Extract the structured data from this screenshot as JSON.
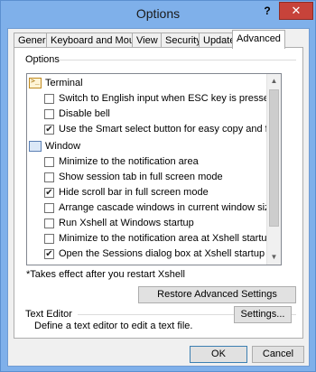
{
  "window": {
    "title": "Options",
    "help_glyph": "?",
    "close_glyph": "✕"
  },
  "tabs": [
    {
      "label": "General"
    },
    {
      "label": "Keyboard and Mouse"
    },
    {
      "label": "View"
    },
    {
      "label": "Security"
    },
    {
      "label": "Update"
    },
    {
      "label": "Advanced"
    }
  ],
  "options": {
    "group_label": "Options",
    "terminal": {
      "category": "Terminal",
      "items": [
        {
          "label": "Switch to English input when ESC key is pressed",
          "checked": false
        },
        {
          "label": "Disable bell",
          "checked": false
        },
        {
          "label": "Use the Smart select button for easy copy and file download",
          "checked": true
        }
      ]
    },
    "window": {
      "category": "Window",
      "items": [
        {
          "label": "Minimize to the notification area",
          "checked": false
        },
        {
          "label": "Show session tab in full screen mode",
          "checked": false
        },
        {
          "label": "Hide scroll bar in full screen mode",
          "checked": true
        },
        {
          "label": "Arrange cascade windows in current window size",
          "checked": false
        },
        {
          "label": "Run Xshell at Windows startup",
          "checked": false
        },
        {
          "label": "Minimize to the notification area at Xshell startup",
          "checked": false
        },
        {
          "label": "Open the Sessions dialog box at Xshell startup",
          "checked": true
        }
      ]
    },
    "note": "*Takes effect after you restart Xshell",
    "restore_button": "Restore Advanced Settings"
  },
  "text_editor": {
    "group_label": "Text Editor",
    "description": "Define a text editor to edit a text file.",
    "settings_button": "Settings..."
  },
  "footer": {
    "ok": "OK",
    "cancel": "Cancel"
  },
  "checkmark": "✔"
}
